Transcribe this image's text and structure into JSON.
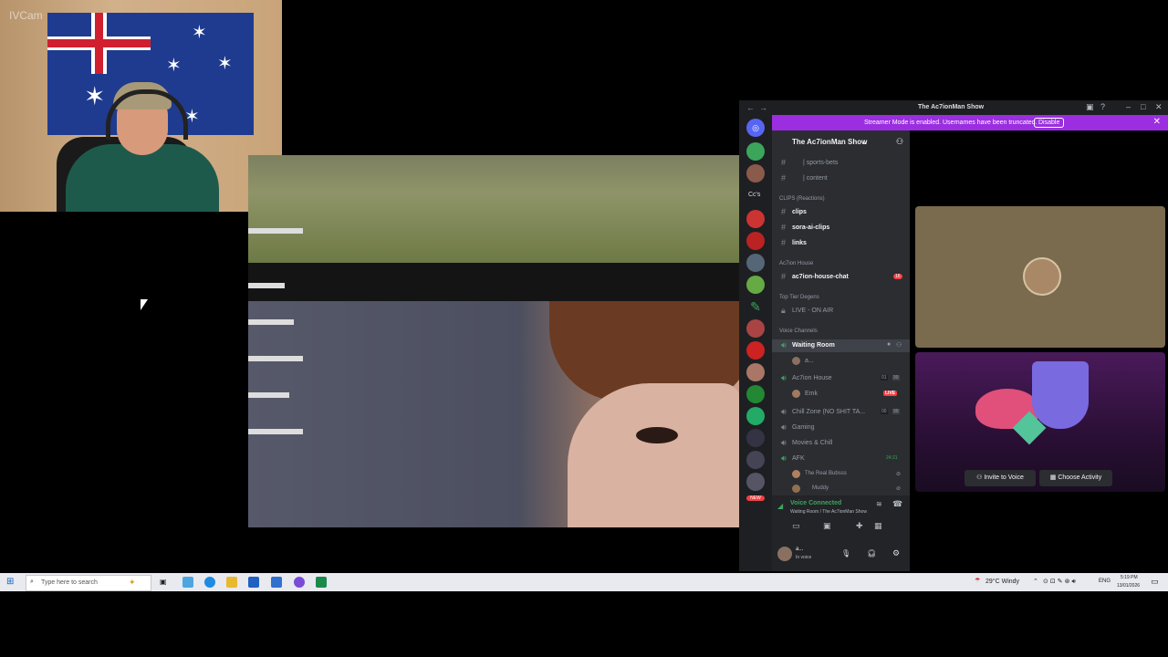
{
  "webcam": {
    "watermark": "IVCam"
  },
  "discord": {
    "window_title": "The Ac7ionMan Show",
    "streamer_banner": "Streamer Mode is enabled. Usernames have been truncated.",
    "streamer_disable": "Disable",
    "server_name": "The Ac7ionMan Show",
    "rail_label_cc": "Cc's",
    "rail_new": "NEW",
    "channels": {
      "sports_bets": "| sports-bets",
      "content": "| content",
      "cat_clips": "CLIPS (Reactions)",
      "clips": "clips",
      "sora": "sora-ai-clips",
      "links": "links",
      "cat_house": "Ac7ion House",
      "house_chat": "ac7ion-house-chat",
      "house_chat_badge": "16",
      "cat_top": "Top Tier Degens",
      "live_on_air": "LIVE - ON AIR",
      "cat_voice": "Voice Channels",
      "waiting_room": "Waiting Room",
      "waiting_user": "a...",
      "ac7ion_house": "Ac7ion House",
      "ac7ion_house_count_a": "01",
      "ac7ion_house_count_b": "99",
      "ac7ion_user": "Emk",
      "live": "LIVE",
      "chill_zone": "Chill Zone (NO SHIT TA...",
      "chill_count_a": "00",
      "chill_count_b": "99",
      "gaming": "Gaming",
      "movies": "Movies & Chill",
      "afk": "AFK",
      "afk_time": "24:21",
      "afk_user1": "The Real Bubsss",
      "afk_user2": "Muddy"
    },
    "voice": {
      "status": "Voice Connected",
      "location": "Waiting Room / The Ac7ionMan Show"
    },
    "user": {
      "name": "a...",
      "status": "In voice"
    },
    "invite": "Invite to Voice",
    "choose_activity": "Choose Activity"
  },
  "taskbar": {
    "search_placeholder": "Type here to search",
    "weather": "29°C Windy",
    "lang": "ENG",
    "time": "5:19 PM",
    "date": "13/01/2026"
  }
}
